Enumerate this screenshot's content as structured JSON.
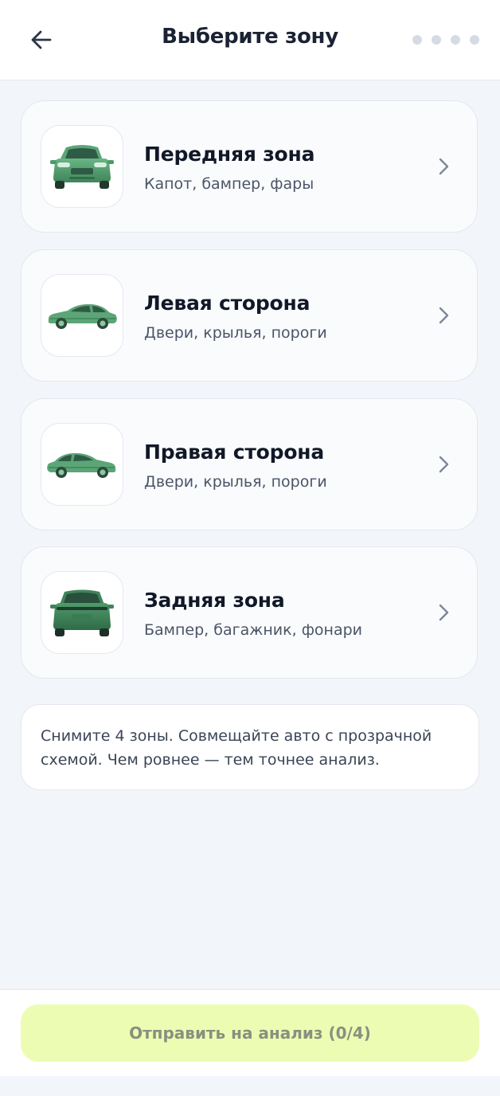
{
  "header": {
    "title": "Выберите зону",
    "back_icon": "arrow-left-icon",
    "progress_dots": 4
  },
  "zones": [
    {
      "title": "Передняя зона",
      "subtitle": "Капот, бампер, фары",
      "icon": "car-front-icon"
    },
    {
      "title": "Левая сторона",
      "subtitle": "Двери, крылья, пороги",
      "icon": "car-side-left-icon"
    },
    {
      "title": "Правая сторона",
      "subtitle": "Двери, крылья, пороги",
      "icon": "car-side-right-icon"
    },
    {
      "title": "Задняя зона",
      "subtitle": "Бампер, багажник, фонари",
      "icon": "car-rear-icon"
    }
  ],
  "info": {
    "text": "Снимите 4 зоны. Совмещайте авто с прозрачной схемой. Чем ровнее — тем точнее анализ."
  },
  "footer": {
    "submit_label": "Отправить на анализ (0/4)"
  },
  "colors": {
    "background": "#f2f5f9",
    "accent": "#ecfdb3",
    "car_green": "#4e9a6a",
    "title": "#111827",
    "subtitle": "#4a5568"
  }
}
